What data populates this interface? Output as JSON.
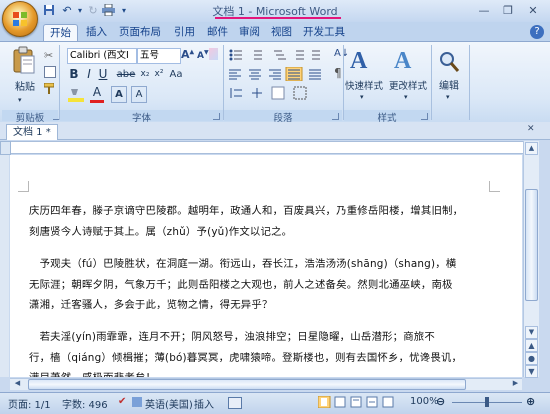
{
  "window": {
    "title_doc": "文档 1",
    "title_sep": " - ",
    "title_app": "Microsoft Word"
  },
  "qat": {
    "icons": [
      "save-icon",
      "undo-icon",
      "redo-icon",
      "print-icon",
      "customize-icon"
    ]
  },
  "tabs": [
    "开始",
    "插入",
    "页面布局",
    "引用",
    "邮件",
    "审阅",
    "视图",
    "开发工具"
  ],
  "ribbon": {
    "clipboard": {
      "paste_label": "粘贴",
      "group_label": "剪贴板"
    },
    "font": {
      "font_name": "Calibri (西文I",
      "font_size": "五号",
      "group_label": "字体",
      "bold": "B",
      "italic": "I",
      "underline": "U",
      "strike": "abe",
      "font_color_glyph": "A",
      "highlight_color": "#f5e33a",
      "font_color": "#e02020"
    },
    "paragraph": {
      "group_label": "段落"
    },
    "styles": {
      "quick_styles": "快速样式",
      "change_styles": "更改样式",
      "group_label": "样式"
    },
    "editing": {
      "label": "编辑"
    }
  },
  "document": {
    "tab_label": "文档 1 *",
    "paragraphs": [
      [
        "庆历四年春，滕子京谪守巴陵郡。越明年，政通人和，百废具兴，乃重修岳阳楼，增其旧制，",
        "刻唐贤今人诗赋于其上。属（zhǔ）予(yǔ)作文以记之。"
      ],
      [
        "　予观夫（fú）巴陵胜状，在洞庭一湖。衔远山，吞长江，浩浩汤汤(shāng)（shang)，横",
        "无际涯；朝晖夕阴，气象万千；此则岳阳楼之大观也，前人之述备矣。然则北通巫峡，南极",
        "潇湘，迁客骚人，多会于此，览物之情，得无异乎？"
      ],
      [
        "　若夫淫(yín)雨霏霏，连月不开；阴风怒号，浊浪排空；日星隐曜，山岳潜形；商旅不",
        "行，樯（qiáng）倾楫摧；薄(bó)暮冥冥，虎啸猿啼。登斯楼也，则有去国怀乡，忧谗畏讥，",
        "满目萧然，感极而悲者矣！"
      ]
    ]
  },
  "status": {
    "page": "页面: 1/1",
    "words": "字数: 496",
    "language": "英语(美国)",
    "insert": "插入",
    "zoom": "100%"
  },
  "colors": {
    "accent_underline": "#e2167b",
    "ribbon_bg": "#dbe8f7"
  }
}
